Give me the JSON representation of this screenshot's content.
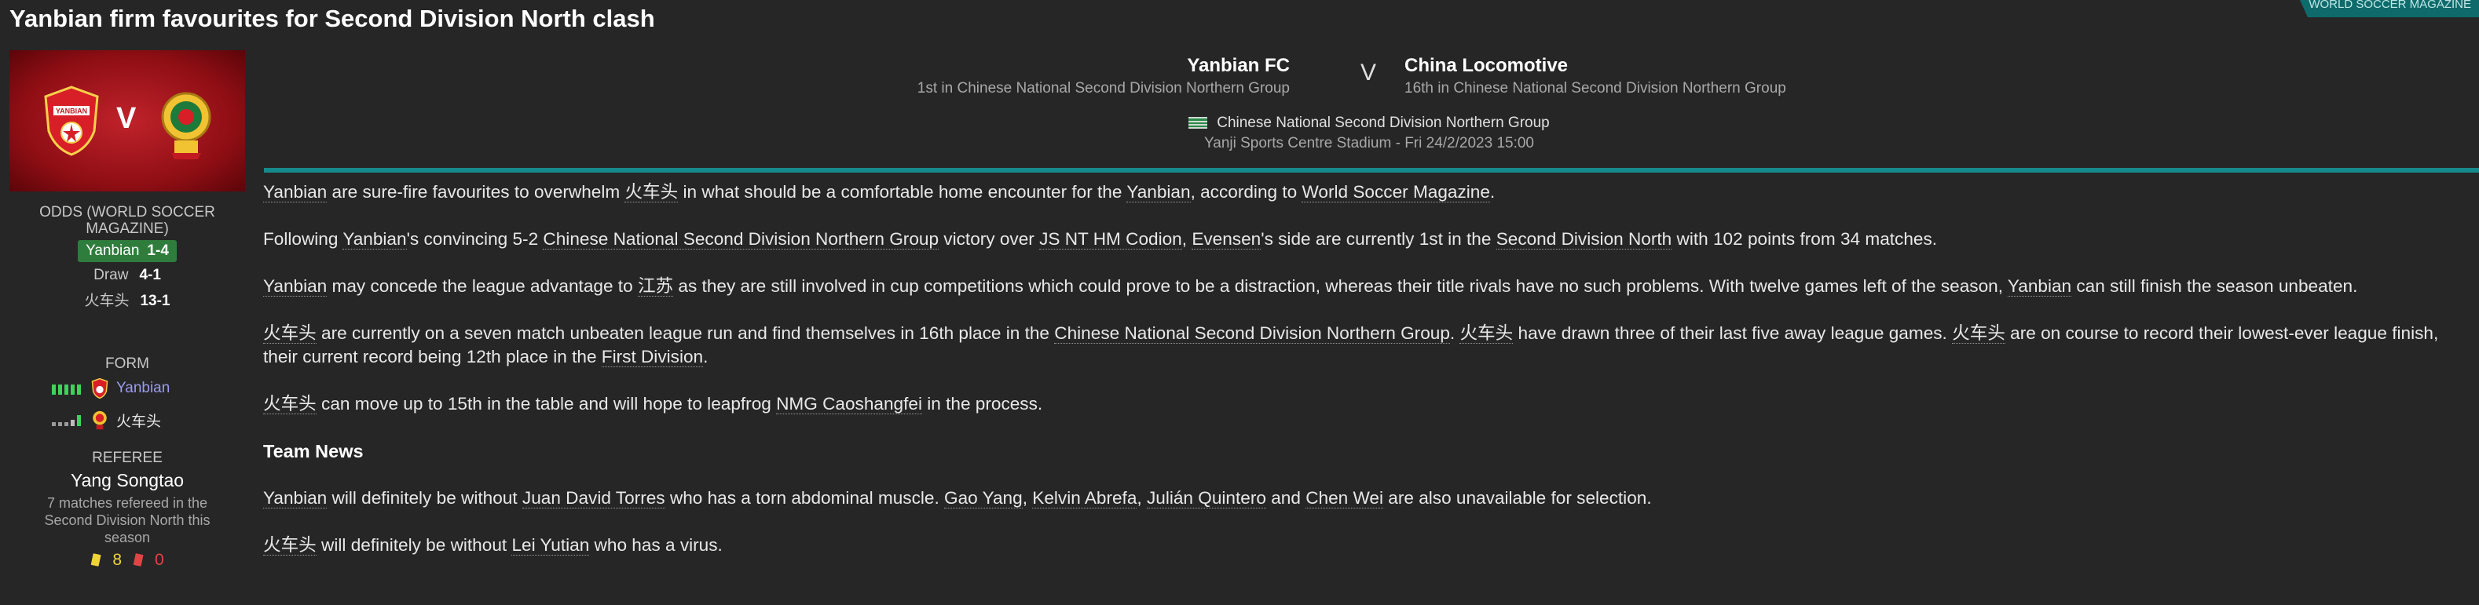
{
  "headline": "Yanbian firm favourites for Second Division North clash",
  "corner_tag": "WORLD SOCCER MAGAZINE",
  "banner": {
    "vs": "V"
  },
  "odds": {
    "title": "ODDS (WORLD SOCCER MAGAZINE)",
    "home_team": "Yanbian",
    "home_odds": "1-4",
    "draw_label": "Draw",
    "draw_odds": "4-1",
    "away_team": "火车头",
    "away_odds": "13-1"
  },
  "form": {
    "title": "FORM",
    "rows": [
      {
        "team": "Yanbian"
      },
      {
        "team": "火车头"
      }
    ]
  },
  "referee": {
    "title": "REFEREE",
    "name": "Yang Songtao",
    "desc": "7 matches refereed in the Second Division North this season",
    "yellow": "8",
    "red": "0"
  },
  "match": {
    "home_name": "Yanbian FC",
    "home_pos": "1st in Chinese National Second Division Northern Group",
    "v": "V",
    "away_name": "China Locomotive",
    "away_pos": "16th in Chinese National Second Division Northern Group",
    "competition": "Chinese National Second Division Northern Group",
    "venue": "Yanji Sports Centre Stadium - Fri 24/2/2023 15:00"
  },
  "article": {
    "p1": [
      "Yanbian",
      " are sure-fire favourites to overwhelm ",
      "火车头",
      " in what should be a comfortable home encounter for the ",
      "Yanbian",
      ", according to ",
      "World Soccer Magazine",
      "."
    ],
    "p2": [
      "Following ",
      "Yanbian",
      "'s convincing 5-2 ",
      "Chinese National Second Division Northern Group",
      " victory over ",
      "JS NT HM Codion",
      ", ",
      "Evensen",
      "'s side are currently 1st in the ",
      "Second Division North",
      " with 102 points from 34 matches."
    ],
    "p3": [
      "Yanbian",
      " may concede the league advantage to ",
      "江苏",
      " as they are still involved in cup competitions which could prove to be a distraction, whereas their title rivals have no such problems. With twelve games left of the season, ",
      "Yanbian",
      " can still finish the season unbeaten."
    ],
    "p4": [
      "火车头",
      " are currently on a seven match unbeaten league run and find themselves in 16th place in the ",
      "Chinese National Second Division Northern Group",
      ". ",
      "火车头",
      " have drawn three of their last five away league games. ",
      "火车头",
      " are on course to record their lowest-ever league finish, their current record being 12th place in the ",
      "First Division",
      "."
    ],
    "p5": [
      "火车头",
      " can move up to 15th in the table and will hope to leapfrog ",
      "NMG Caoshangfei",
      " in the process."
    ],
    "team_news_heading": "Team News",
    "p6": [
      "Yanbian",
      " will definitely be without ",
      "Juan David Torres",
      " who has a torn abdominal muscle. ",
      "Gao Yang",
      ", ",
      "Kelvin Abrefa",
      ", ",
      "Julián Quintero",
      " and ",
      "Chen Wei",
      " are also unavailable for selection."
    ],
    "p7": [
      "火车头",
      " will definitely be without ",
      "Lei Yutian",
      " who has a virus."
    ]
  },
  "colors": {
    "accent": "#168a8a",
    "odds_green": "#2f7d3c",
    "banner_red": "#b01a22",
    "link_purple": "#9b9bf2"
  },
  "icons": [
    "yanbian-crest-icon",
    "locomotive-crest-icon",
    "china-flag-icon",
    "form-bars-icon",
    "yellow-card-icon",
    "red-card-icon"
  ]
}
